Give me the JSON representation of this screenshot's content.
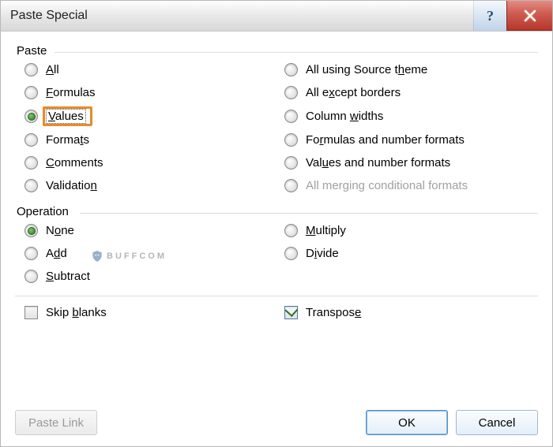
{
  "title": "Paste Special",
  "groups": {
    "paste": {
      "label": "Paste",
      "left": [
        {
          "label": "All",
          "underline": 0,
          "checked": false
        },
        {
          "label": "Formulas",
          "underline": 0,
          "checked": false
        },
        {
          "label": "Values",
          "underline": 0,
          "checked": true,
          "highlighted": true,
          "focused": true
        },
        {
          "label": "Formats",
          "underline": 5,
          "checked": false
        },
        {
          "label": "Comments",
          "underline": 0,
          "checked": false
        },
        {
          "label": "Validation",
          "underline": 8,
          "checked": false
        }
      ],
      "right": [
        {
          "label": "All using Source theme",
          "underline": 17,
          "checked": false
        },
        {
          "label": "All except borders",
          "underline": 4,
          "checked": false
        },
        {
          "label": "Column widths",
          "underline": 7,
          "checked": false
        },
        {
          "label": "Formulas and number formats",
          "underline": 2,
          "checked": false
        },
        {
          "label": "Values and number formats",
          "underline": 3,
          "checked": false
        },
        {
          "label": "All merging conditional formats",
          "underline": 11,
          "checked": false,
          "disabled": true
        }
      ]
    },
    "operation": {
      "label": "Operation",
      "left": [
        {
          "label": "None",
          "underline": 1,
          "checked": true
        },
        {
          "label": "Add",
          "underline": 1,
          "checked": false
        },
        {
          "label": "Subtract",
          "underline": 0,
          "checked": false
        }
      ],
      "right": [
        {
          "label": "Multiply",
          "underline": 0,
          "checked": false
        },
        {
          "label": "Divide",
          "underline": 1,
          "checked": false
        }
      ]
    }
  },
  "checks": {
    "skip_blanks": {
      "label": "Skip blanks",
      "underline": 5,
      "checked": false
    },
    "transpose": {
      "label": "Transpose",
      "underline": 8,
      "checked": true
    }
  },
  "buttons": {
    "paste_link": "Paste Link",
    "ok": "OK",
    "cancel": "Cancel"
  },
  "watermark": "BUFFCOM"
}
